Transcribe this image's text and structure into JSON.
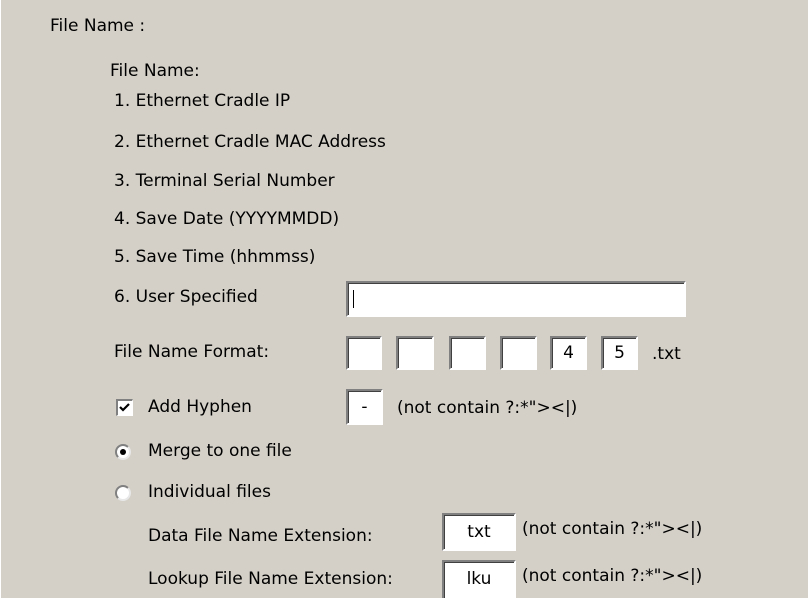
{
  "section_title": "File Name :",
  "heading": "File Name:",
  "items": [
    "1. Ethernet Cradle IP",
    "2. Ethernet Cradle MAC Address",
    "3. Terminal Serial Number",
    "4. Save Date (YYYYMMDD)",
    "5. Save Time (hhmmss)"
  ],
  "user_specified": {
    "label": "6. User Specified",
    "value": ""
  },
  "format": {
    "label": "File Name Format:",
    "slots": [
      "",
      "",
      "",
      "",
      "4",
      "5"
    ],
    "suffix": ".txt"
  },
  "hyphen": {
    "label": "Add Hyphen",
    "checked": true,
    "value": "-",
    "note": "(not contain ?:*\"><|)"
  },
  "merge": {
    "label": "Merge to one file",
    "selected": true
  },
  "individual": {
    "label": "Individual files",
    "selected": false
  },
  "data_ext": {
    "label": "Data File Name Extension:",
    "value": "txt",
    "note": "(not contain ?:*\"><|)"
  },
  "lookup_ext": {
    "label": "Lookup File Name Extension:",
    "value": "lku",
    "note": "(not contain ?:*\"><|)"
  }
}
